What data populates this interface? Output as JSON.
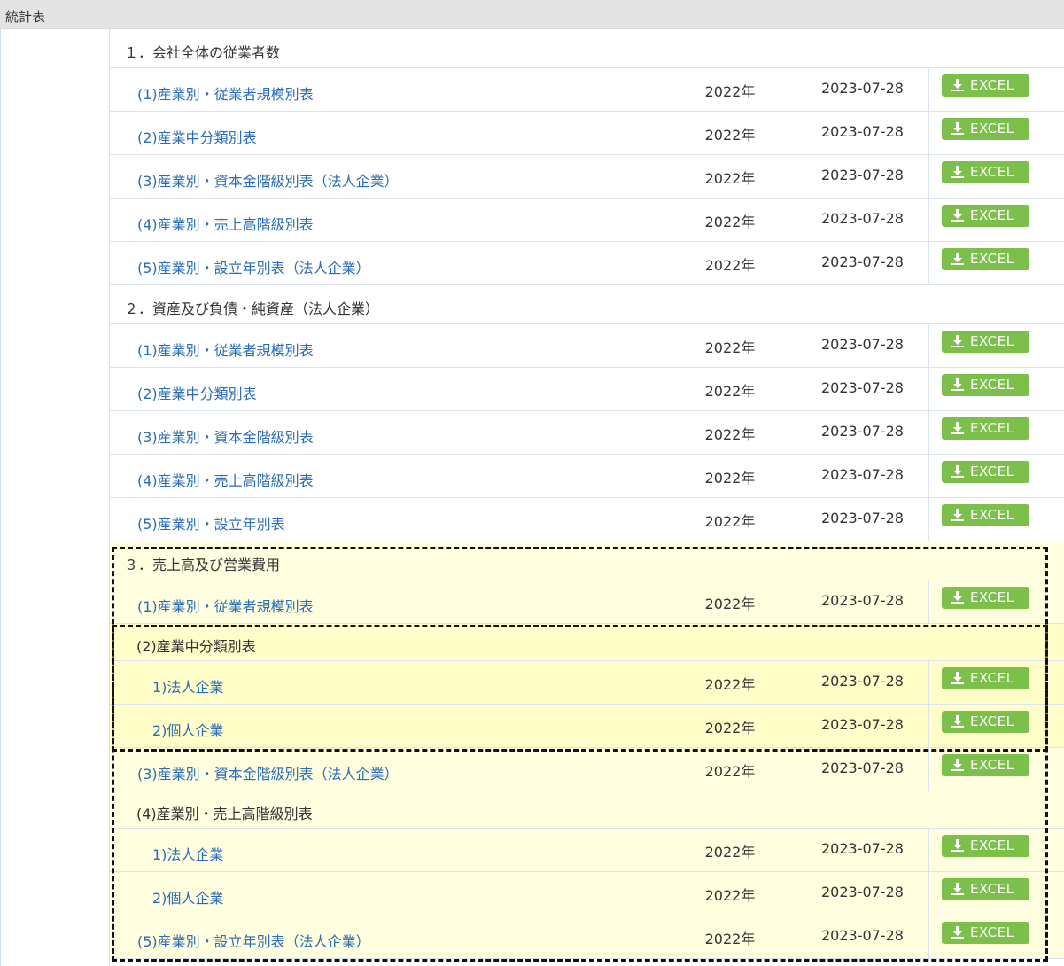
{
  "page_title": "統計表",
  "excel_label": "EXCEL",
  "sections": [
    {
      "title": "１．会社全体の従業者数",
      "rows": [
        {
          "label": "(1)産業別・従業者規模別表",
          "year": "2022年",
          "date": "2023-07-28"
        },
        {
          "label": "(2)産業中分類別表",
          "year": "2022年",
          "date": "2023-07-28"
        },
        {
          "label": "(3)産業別・資本金階級別表（法人企業）",
          "year": "2022年",
          "date": "2023-07-28"
        },
        {
          "label": "(4)産業別・売上高階級別表",
          "year": "2022年",
          "date": "2023-07-28"
        },
        {
          "label": "(5)産業別・設立年別表（法人企業）",
          "year": "2022年",
          "date": "2023-07-28"
        }
      ]
    },
    {
      "title": "２．資産及び負債・純資産（法人企業）",
      "rows": [
        {
          "label": "(1)産業別・従業者規模別表",
          "year": "2022年",
          "date": "2023-07-28"
        },
        {
          "label": "(2)産業中分類別表",
          "year": "2022年",
          "date": "2023-07-28"
        },
        {
          "label": "(3)産業別・資本金階級別表",
          "year": "2022年",
          "date": "2023-07-28"
        },
        {
          "label": "(4)産業別・売上高階級別表",
          "year": "2022年",
          "date": "2023-07-28"
        },
        {
          "label": "(5)産業別・設立年別表",
          "year": "2022年",
          "date": "2023-07-28"
        }
      ]
    },
    {
      "title": "３．売上高及び営業費用",
      "rows": [
        {
          "label": "(1)産業別・従業者規模別表",
          "year": "2022年",
          "date": "2023-07-28"
        },
        {
          "sub_title": "(2)産業中分類別表"
        },
        {
          "label": "1)法人企業",
          "year": "2022年",
          "date": "2023-07-28"
        },
        {
          "label": "2)個人企業",
          "year": "2022年",
          "date": "2023-07-28"
        },
        {
          "label": "(3)産業別・資本金階級別表（法人企業）",
          "year": "2022年",
          "date": "2023-07-28"
        },
        {
          "sub_title": "(4)産業別・売上高階級別表"
        },
        {
          "label": "1)法人企業",
          "year": "2022年",
          "date": "2023-07-28"
        },
        {
          "label": "2)個人企業",
          "year": "2022年",
          "date": "2023-07-28"
        },
        {
          "label": "(5)産業別・設立年別表（法人企業）",
          "year": "2022年",
          "date": "2023-07-28"
        }
      ]
    }
  ],
  "colors": {
    "excel_button": "#7cc04b",
    "link": "#2a6db5",
    "highlight": "#ffffe0",
    "highlight_strong": "#fffdc8"
  }
}
